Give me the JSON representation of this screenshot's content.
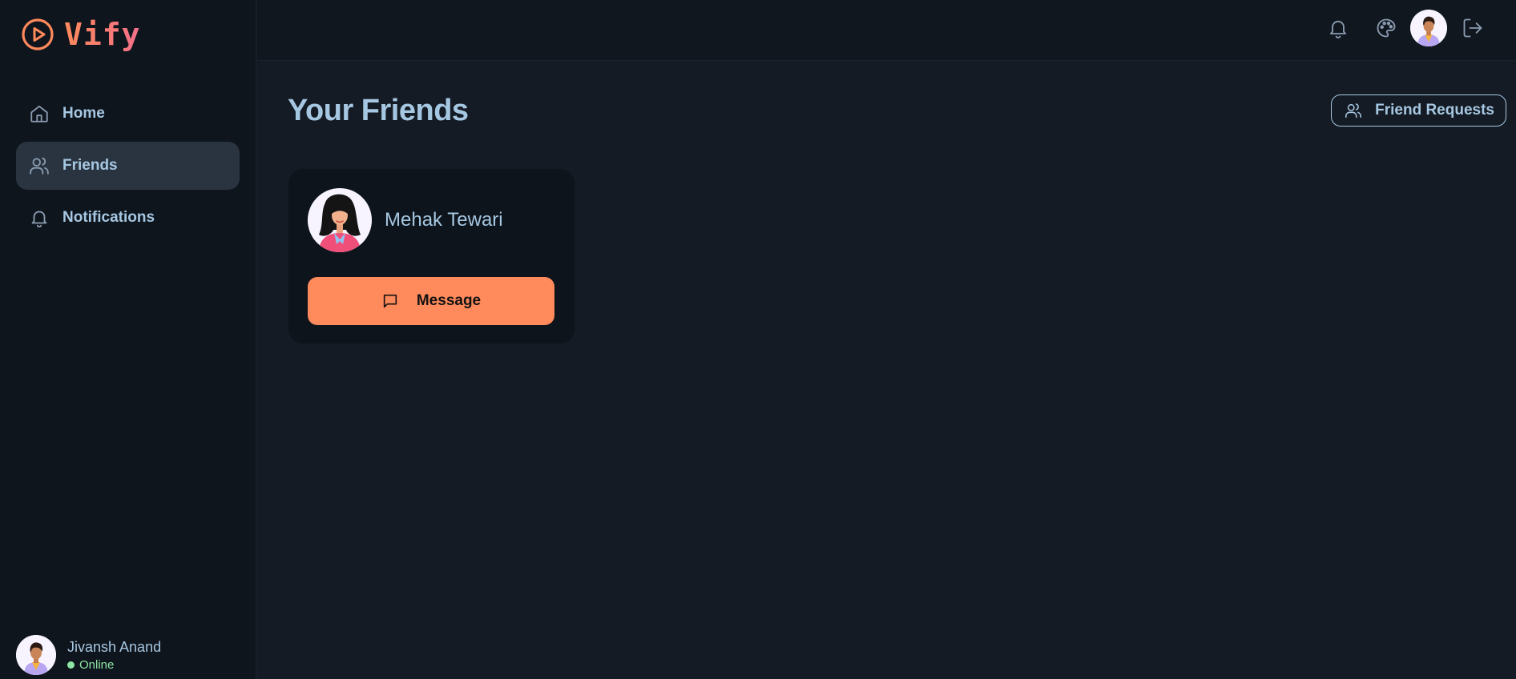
{
  "app": {
    "name": "Vify"
  },
  "sidebar": {
    "items": [
      {
        "label": "Home",
        "icon": "home-icon",
        "active": false
      },
      {
        "label": "Friends",
        "icon": "users-icon",
        "active": true
      },
      {
        "label": "Notifications",
        "icon": "bell-icon",
        "active": false
      }
    ],
    "profile": {
      "name": "Jivansh Anand",
      "status": "Online"
    }
  },
  "topbar": {
    "icons": [
      "bell-icon",
      "palette-icon",
      "avatar",
      "logout-icon"
    ]
  },
  "main": {
    "title": "Your Friends",
    "friend_requests_label": "Friend Requests",
    "friends": [
      {
        "name": "Mehak Tewari",
        "action_label": "Message"
      }
    ]
  },
  "colors": {
    "accent": "#ff8a5b",
    "text": "#a6c7e2",
    "background": "#141b24",
    "sidebar": "#0f151d",
    "online": "#8ee6a5"
  }
}
